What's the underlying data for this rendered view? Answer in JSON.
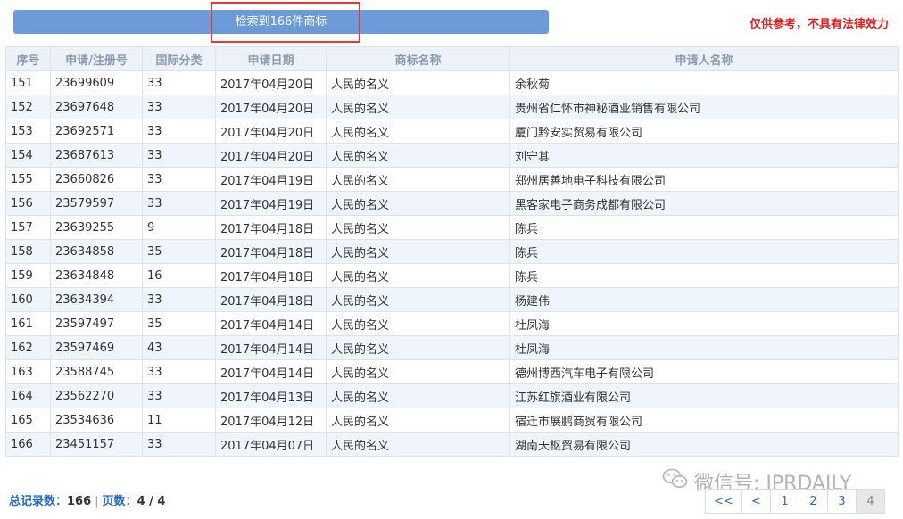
{
  "search": {
    "result_count_label": "检索到166件商标",
    "disclaimer": "仅供参考，不具有法律效力"
  },
  "table": {
    "headers": [
      "序号",
      "申请/注册号",
      "国际分类",
      "申请日期",
      "商标名称",
      "申请人名称"
    ],
    "rows": [
      [
        "151",
        "23699609",
        "33",
        "2017年04月20日",
        "人民的名义",
        "余秋菊"
      ],
      [
        "152",
        "23697648",
        "33",
        "2017年04月20日",
        "人民的名义",
        "贵州省仁怀市神秘酒业销售有限公司"
      ],
      [
        "153",
        "23692571",
        "33",
        "2017年04月20日",
        "人民的名义",
        "厦门黔安实贸易有限公司"
      ],
      [
        "154",
        "23687613",
        "33",
        "2017年04月20日",
        "人民的名义",
        "刘守其"
      ],
      [
        "155",
        "23660826",
        "33",
        "2017年04月19日",
        "人民的名义",
        "郑州居善地电子科技有限公司"
      ],
      [
        "156",
        "23579597",
        "33",
        "2017年04月19日",
        "人民的名义",
        "黑客家电子商务成都有限公司"
      ],
      [
        "157",
        "23639255",
        "9",
        "2017年04月18日",
        "人民的名义",
        "陈兵"
      ],
      [
        "158",
        "23634858",
        "35",
        "2017年04月18日",
        "人民的名义",
        "陈兵"
      ],
      [
        "159",
        "23634848",
        "16",
        "2017年04月18日",
        "人民的名义",
        "陈兵"
      ],
      [
        "160",
        "23634394",
        "33",
        "2017年04月18日",
        "人民的名义",
        "杨建伟"
      ],
      [
        "161",
        "23597497",
        "35",
        "2017年04月14日",
        "人民的名义",
        "杜凤海"
      ],
      [
        "162",
        "23597469",
        "43",
        "2017年04月14日",
        "人民的名义",
        "杜凤海"
      ],
      [
        "163",
        "23588745",
        "33",
        "2017年04月14日",
        "人民的名义",
        "德州博西汽车电子有限公司"
      ],
      [
        "164",
        "23562270",
        "33",
        "2017年04月13日",
        "人民的名义",
        "江苏红旗酒业有限公司"
      ],
      [
        "165",
        "23534636",
        "11",
        "2017年04月12日",
        "人民的名义",
        "宿迁市展鹏商贸有限公司"
      ],
      [
        "166",
        "23451157",
        "33",
        "2017年04月07日",
        "人民的名义",
        "湖南天枢贸易有限公司"
      ]
    ]
  },
  "summary": {
    "total_label": "总记录数：",
    "total_value": "166",
    "sep": "|",
    "pages_label": "页数：",
    "pages_value": "4 / 4"
  },
  "watermark": {
    "text": "微信号: IPRDAILY",
    "icon": "wechat-icon"
  },
  "pagination": {
    "buttons": [
      {
        "label": "<<",
        "name": "first-page-button",
        "current": false
      },
      {
        "label": "<",
        "name": "prev-page-button",
        "current": false
      },
      {
        "label": "1",
        "name": "page-1-button",
        "current": false
      },
      {
        "label": "2",
        "name": "page-2-button",
        "current": false
      },
      {
        "label": "3",
        "name": "page-3-button",
        "current": false
      },
      {
        "label": "4",
        "name": "page-4-button",
        "current": true
      }
    ]
  },
  "colors": {
    "bar": "#6d9ad8",
    "link": "#2a6bc2",
    "disclaimer": "#e02020",
    "highlight": "#e53935"
  }
}
